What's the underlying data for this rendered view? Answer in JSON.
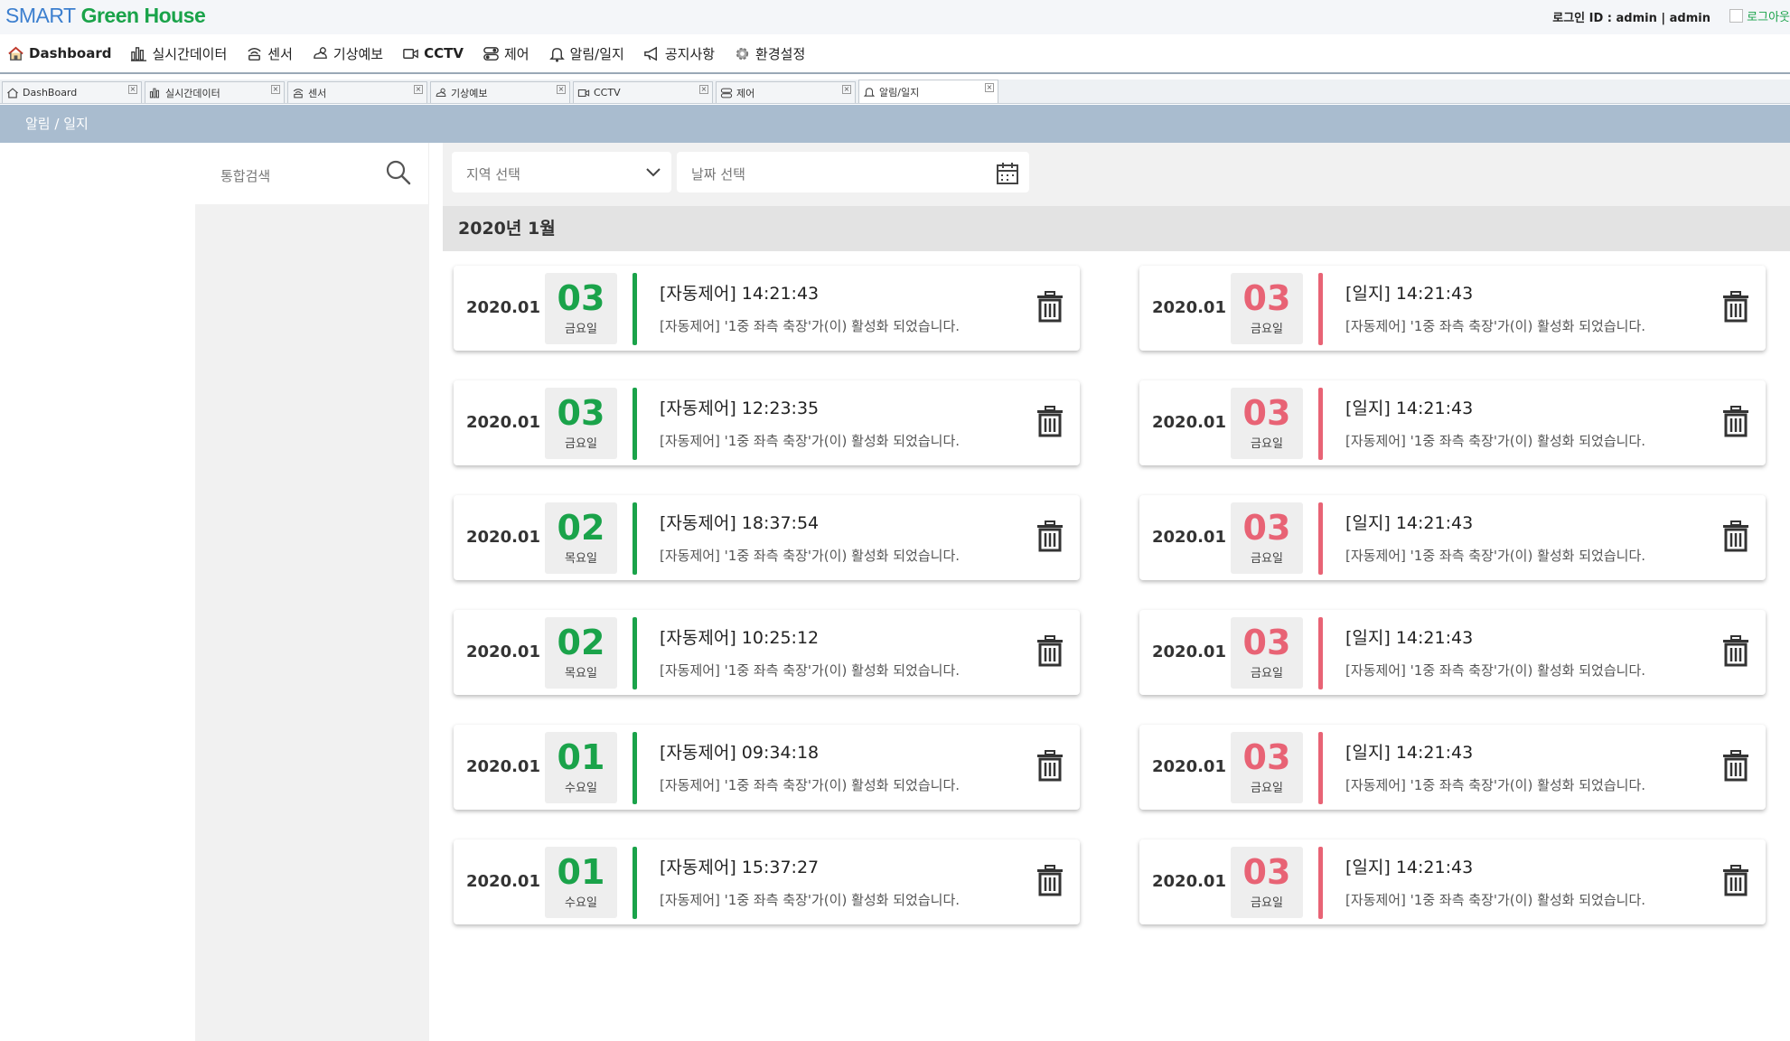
{
  "app": {
    "logo_smart": "SMART",
    "logo_green": "Green House",
    "login_info": "로그인 ID : admin | admin",
    "logout_label": "로그아웃"
  },
  "menu": [
    {
      "label": "Dashboard",
      "icon": "home-icon"
    },
    {
      "label": "실시간데이터",
      "icon": "bar-chart-icon"
    },
    {
      "label": "센서",
      "icon": "sensor-icon"
    },
    {
      "label": "기상예보",
      "icon": "weather-icon"
    },
    {
      "label": "CCTV",
      "icon": "video-camera-icon"
    },
    {
      "label": "제어",
      "icon": "control-icon"
    },
    {
      "label": "알림/일지",
      "icon": "bell-icon"
    },
    {
      "label": "공지사항",
      "icon": "megaphone-icon"
    },
    {
      "label": "환경설정",
      "icon": "gear-icon"
    }
  ],
  "tabs": [
    {
      "label": "DashBoard",
      "icon": "home-icon"
    },
    {
      "label": "실시간데이터",
      "icon": "bar-chart-icon"
    },
    {
      "label": "센서",
      "icon": "sensor-icon"
    },
    {
      "label": "기상예보",
      "icon": "weather-icon"
    },
    {
      "label": "CCTV",
      "icon": "video-camera-icon"
    },
    {
      "label": "제어",
      "icon": "control-icon"
    },
    {
      "label": "알림/일지",
      "icon": "bell-icon",
      "active": true
    }
  ],
  "page_title": "알림 / 일지",
  "search": {
    "placeholder": "통합검색"
  },
  "filters": {
    "region_placeholder": "지역 선택",
    "date_placeholder": "날짜 선택"
  },
  "month_header": "2020년 1월",
  "colors": {
    "control": "#1aa34a",
    "journal": "#e86375",
    "header": "#a9bccf"
  },
  "auto_control": [
    {
      "ym": "2020.01",
      "day": "03",
      "weekday": "금요일",
      "title": "[자동제어] 14:21:43",
      "message": "[자동제어] '1중 좌측 축장'가(이) 활성화 되었습니다."
    },
    {
      "ym": "2020.01",
      "day": "03",
      "weekday": "금요일",
      "title": "[자동제어] 12:23:35",
      "message": "[자동제어] '1중 좌측 축장'가(이) 활성화 되었습니다."
    },
    {
      "ym": "2020.01",
      "day": "02",
      "weekday": "목요일",
      "title": "[자동제어] 18:37:54",
      "message": "[자동제어] '1중 좌측 축장'가(이) 활성화 되었습니다."
    },
    {
      "ym": "2020.01",
      "day": "02",
      "weekday": "목요일",
      "title": "[자동제어] 10:25:12",
      "message": "[자동제어] '1중 좌측 축장'가(이) 활성화 되었습니다."
    },
    {
      "ym": "2020.01",
      "day": "01",
      "weekday": "수요일",
      "title": "[자동제어] 09:34:18",
      "message": "[자동제어] '1중 좌측 축장'가(이) 활성화 되었습니다."
    },
    {
      "ym": "2020.01",
      "day": "01",
      "weekday": "수요일",
      "title": "[자동제어] 15:37:27",
      "message": "[자동제어] '1중 좌측 축장'가(이) 활성화 되었습니다."
    }
  ],
  "journal": [
    {
      "ym": "2020.01",
      "day": "03",
      "weekday": "금요일",
      "title": "[일지] 14:21:43",
      "message": "[자동제어] '1중 좌측 축장'가(이) 활성화 되었습니다."
    },
    {
      "ym": "2020.01",
      "day": "03",
      "weekday": "금요일",
      "title": "[일지] 14:21:43",
      "message": "[자동제어] '1중 좌측 축장'가(이) 활성화 되었습니다."
    },
    {
      "ym": "2020.01",
      "day": "03",
      "weekday": "금요일",
      "title": "[일지] 14:21:43",
      "message": "[자동제어] '1중 좌측 축장'가(이) 활성화 되었습니다."
    },
    {
      "ym": "2020.01",
      "day": "03",
      "weekday": "금요일",
      "title": "[일지] 14:21:43",
      "message": "[자동제어] '1중 좌측 축장'가(이) 활성화 되었습니다."
    },
    {
      "ym": "2020.01",
      "day": "03",
      "weekday": "금요일",
      "title": "[일지] 14:21:43",
      "message": "[자동제어] '1중 좌측 축장'가(이) 활성화 되었습니다."
    },
    {
      "ym": "2020.01",
      "day": "03",
      "weekday": "금요일",
      "title": "[일지] 14:21:43",
      "message": "[자동제어] '1중 좌측 축장'가(이) 활성화 되었습니다."
    }
  ]
}
